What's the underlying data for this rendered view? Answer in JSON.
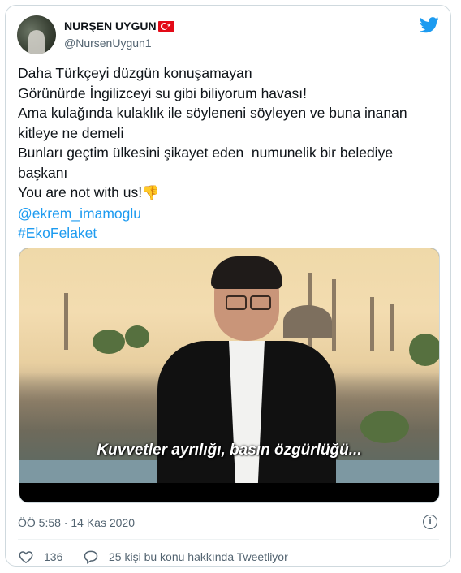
{
  "tweet": {
    "display_name": "NURŞEN UYGUN",
    "handle": "@NursenUygun1",
    "text_lines": [
      "Daha Türkçeyi düzgün konuşamayan",
      "Görünürde İngilizceyi su gibi biliyorum havası!",
      "Ama kulağında kulaklık ile söyleneni söyleyen ve buna inanan",
      "kitleye ne demeli",
      "Bunları geçtim ülkesini şikayet eden  numunelik bir belediye",
      "başkanı",
      "You are not with us!"
    ],
    "thumb_emoji": "👎",
    "mention": "@ekrem_imamoglu",
    "hashtag": "#EkoFelaket",
    "media": {
      "subtitle": "Kuvvetler ayrılığı, basın özgürlüğü..."
    },
    "timestamp": "ÖÖ 5:58 · 14 Kas 2020",
    "likes": "136",
    "reply_text": "25 kişi bu konu hakkında Tweetliyor"
  },
  "colors": {
    "link": "#1d9bf0",
    "muted": "#536471",
    "twitter_blue": "#1d9bf0",
    "flag_red": "#e30a17"
  },
  "icons": [
    "twitter-bird-icon",
    "turkey-flag-icon",
    "info-icon",
    "heart-icon",
    "reply-bubble-icon"
  ]
}
